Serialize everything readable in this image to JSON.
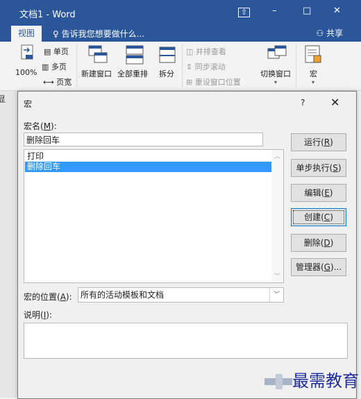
{
  "window": {
    "title": "文档1 - Word",
    "restore_icon": "restore-box-icon",
    "min_label": "–",
    "max_label": "□",
    "close_label": "✕"
  },
  "ribbon": {
    "active_tab": "视图",
    "tell_me": "告诉我您想要做什么...",
    "share": "共享",
    "zoom_100": "100%",
    "single_page": "单页",
    "multi_page": "多页",
    "page_width": "页宽",
    "new_window": "新建窗口",
    "arrange_all": "全部重排",
    "split": "拆分",
    "side_by_side": "并排查看",
    "sync_scroll": "同步滚动",
    "reset_position": "重设窗口位置",
    "switch_windows": "切换窗口",
    "macros": "宏"
  },
  "doc_margin_char": "显",
  "dialog": {
    "title": "宏",
    "help": "?",
    "close": "✕",
    "macro_name_label": "宏名(",
    "macro_name_key": "M",
    "macro_name_suffix": "):",
    "macro_name_value": "删除回车",
    "macro_list": [
      {
        "name": "打印",
        "selected": false
      },
      {
        "name": "删除回车",
        "selected": true
      }
    ],
    "buttons": [
      {
        "name": "run",
        "text": "运行(",
        "key": "R",
        "end": ")",
        "focus": false
      },
      {
        "name": "step-into",
        "text": "单步执行(",
        "key": "S",
        "end": ")",
        "focus": false
      },
      {
        "name": "edit",
        "text": "编辑(",
        "key": "E",
        "end": ")",
        "focus": false
      },
      {
        "name": "create",
        "text": "创建(",
        "key": "C",
        "end": ")",
        "focus": true
      },
      {
        "name": "delete",
        "text": "删除(",
        "key": "D",
        "end": ")",
        "focus": false
      },
      {
        "name": "organizer",
        "text": "管理器(",
        "key": "G",
        "end": ")...",
        "focus": false
      }
    ],
    "location_label": "宏的位置(",
    "location_key": "A",
    "location_suffix": "):",
    "location_value": "所有的活动模板和文档",
    "description_label": "说明(",
    "description_key": "I",
    "description_suffix": "):",
    "description_value": ""
  },
  "watermark": {
    "text": "最需教育"
  }
}
